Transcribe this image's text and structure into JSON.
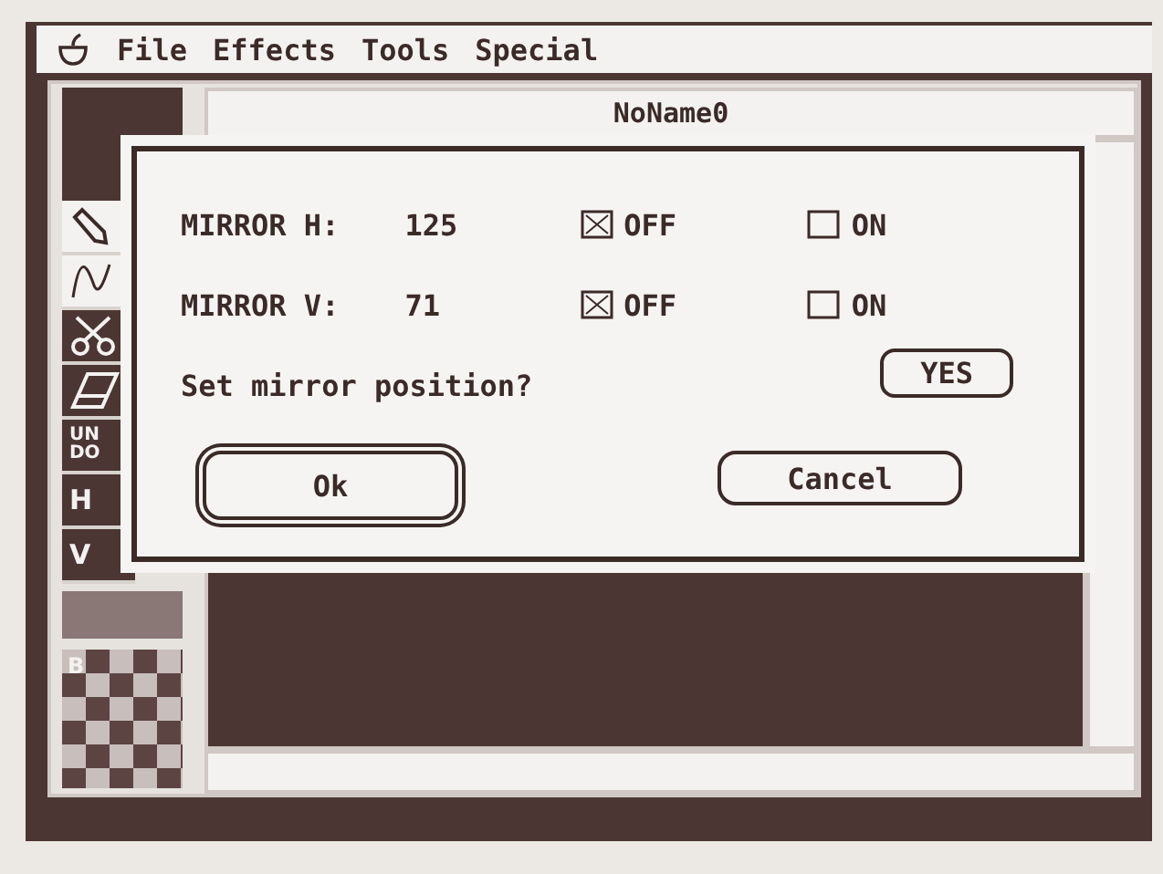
{
  "menu_bar": {
    "items": [
      "File",
      "Effects",
      "Tools",
      "Special"
    ]
  },
  "window": {
    "title": "NoName0"
  },
  "tools": [
    {
      "kind": "pencil",
      "selected": true
    },
    {
      "kind": "curve",
      "selected": true
    },
    {
      "kind": "scissors",
      "selected": false
    },
    {
      "kind": "eraser",
      "selected": false
    },
    {
      "kind": "text",
      "label": "UN\nDO",
      "selected": false
    },
    {
      "kind": "text",
      "label": "H",
      "selected": false
    },
    {
      "kind": "text",
      "label": "V",
      "selected": false
    }
  ],
  "palette": {
    "label": "B"
  },
  "dialog": {
    "rows": [
      {
        "label": "MIRROR H:",
        "value": "125",
        "options": [
          {
            "label": "OFF",
            "selected": true
          },
          {
            "label": "ON",
            "selected": false
          }
        ]
      },
      {
        "label": "MIRROR V:",
        "value": "71",
        "options": [
          {
            "label": "OFF",
            "selected": true
          },
          {
            "label": "ON",
            "selected": false
          }
        ]
      }
    ],
    "question": "Set mirror position?",
    "question_button": "YES",
    "buttons": [
      {
        "label": "Ok",
        "default": true
      },
      {
        "label": "Cancel",
        "default": false
      }
    ]
  }
}
